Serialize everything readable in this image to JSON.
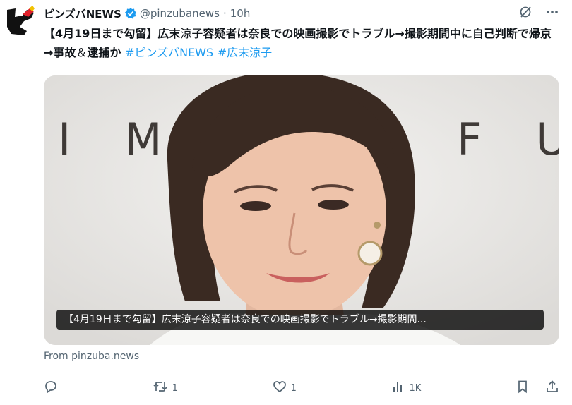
{
  "tweet": {
    "author_name": "ピンズバNEWS",
    "handle": "@pinzubanews",
    "separator": "·",
    "time": "10h",
    "text_part1": "【4月19日まで勾留】広末",
    "text_part2": "涼子",
    "text_part3": "容疑者は奈良での映画撮影でトラブル→撮影期間中に自己判断で帰京→事故",
    "text_part4": "＆",
    "text_part5": "逮捕か ",
    "hashtag1": "#ピンズバNEWS",
    "hashtag2": "#広末涼子"
  },
  "card": {
    "backdrop_left": "I M",
    "backdrop_right": "F U",
    "caption": "【4月19日まで勾留】広末涼子容疑者は奈良での映画撮影でトラブル→撮影期間..."
  },
  "source": "From pinzuba.news",
  "actions": {
    "retweets": "1",
    "likes": "1",
    "views": "1K"
  },
  "colors": {
    "accent": "#1d9bf0",
    "muted": "#536471",
    "text": "#0f1419"
  }
}
